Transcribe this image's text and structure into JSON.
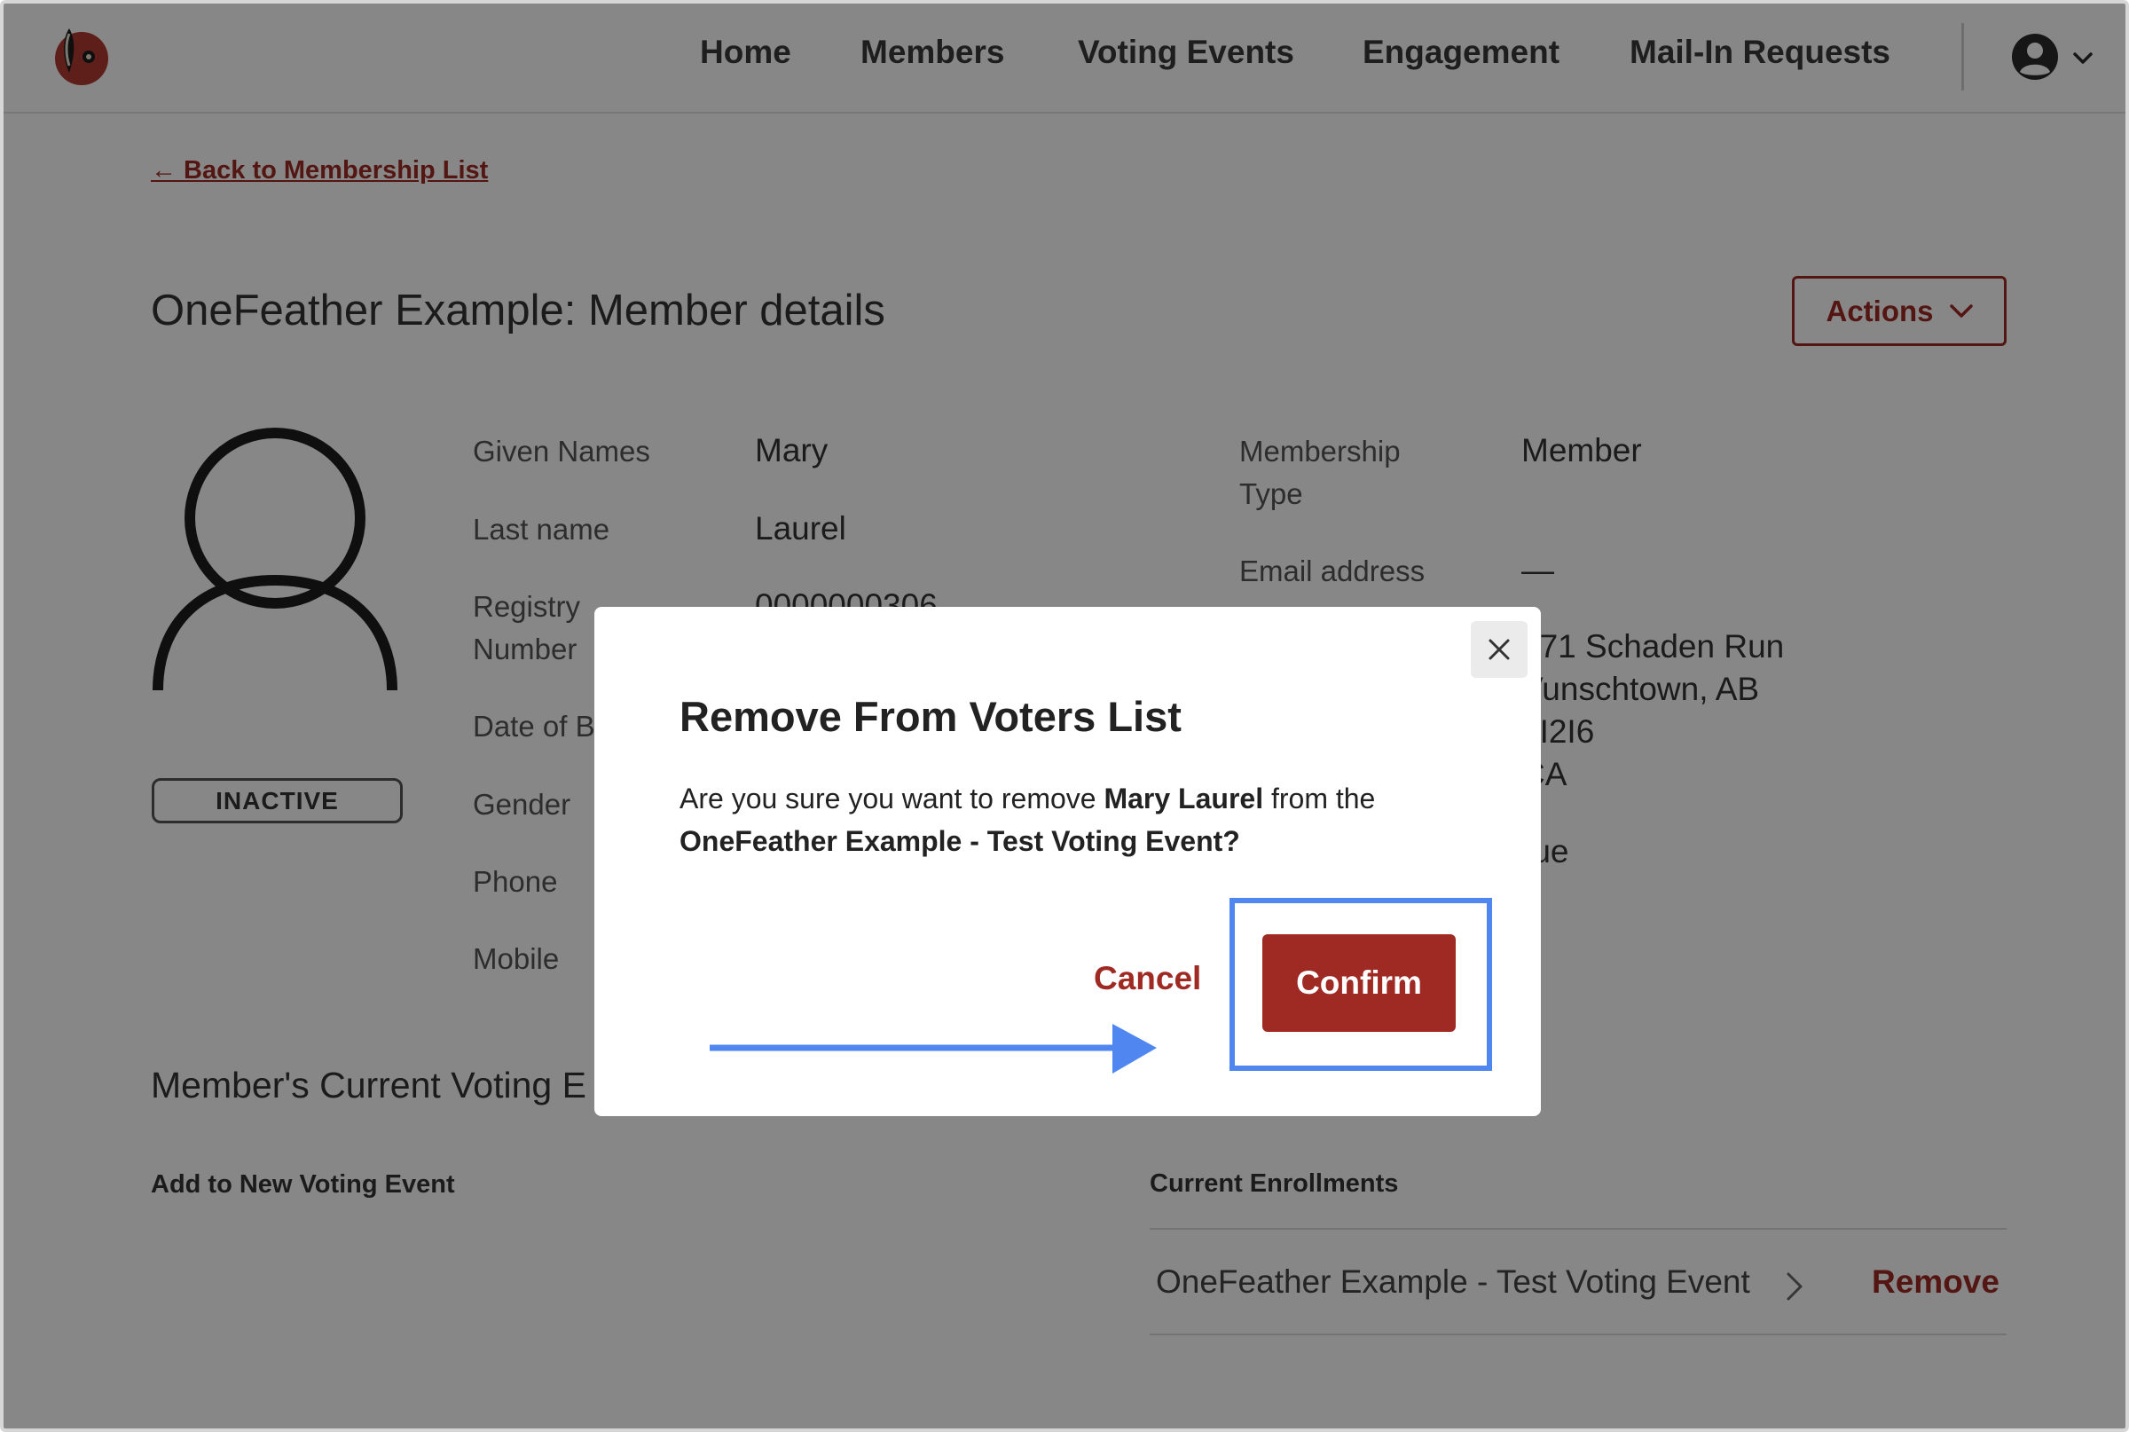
{
  "nav": {
    "links": [
      "Home",
      "Members",
      "Voting Events",
      "Engagement",
      "Mail-In Requests"
    ]
  },
  "page": {
    "back_link": "← Back to Membership List",
    "title": "OneFeather Example: Member details",
    "actions_label": "Actions",
    "status": "INACTIVE"
  },
  "details_left": [
    {
      "label": "Given Names",
      "value": "Mary"
    },
    {
      "label": "Last name",
      "value": "Laurel"
    },
    {
      "label": "Registry\nNumber",
      "value": "0000000306"
    },
    {
      "label": "Date of B",
      "value": ""
    },
    {
      "label": "Gender",
      "value": ""
    },
    {
      "label": "Phone",
      "value": ""
    },
    {
      "label": "Mobile",
      "value": ""
    }
  ],
  "details_right": [
    {
      "label": "Membership\nType",
      "value": "Member"
    },
    {
      "label": "Email address",
      "value": "—"
    }
  ],
  "address_lines": [
    "071 Schaden Run",
    "Vunschtown, AB",
    "6I2I6",
    "CA"
  ],
  "extra_value": "rue",
  "section": {
    "title": "Member's Current Voting E",
    "add_heading": "Add to New Voting Event",
    "current_heading": "Current Enrollments",
    "enrollment_name": "OneFeather Example - Test Voting Event",
    "remove_label": "Remove"
  },
  "modal": {
    "title": "Remove From Voters List",
    "msg_pre": "Are you sure you want to remove ",
    "member_name": "Mary Laurel",
    "msg_mid": " from the",
    "event_name": "OneFeather Example - Test Voting Event?",
    "cancel_label": "Cancel",
    "confirm_label": "Confirm"
  },
  "icons": {
    "logo": "feather-logo-icon",
    "user": "user-circle-icon",
    "chevron": "chevron-down-icon",
    "close": "close-icon",
    "arrow": "arrow-right-icon"
  },
  "colors": {
    "brand": "#9f2a24",
    "highlight": "#4f86f0",
    "overlay": "rgba(0,0,0,0.47)"
  }
}
